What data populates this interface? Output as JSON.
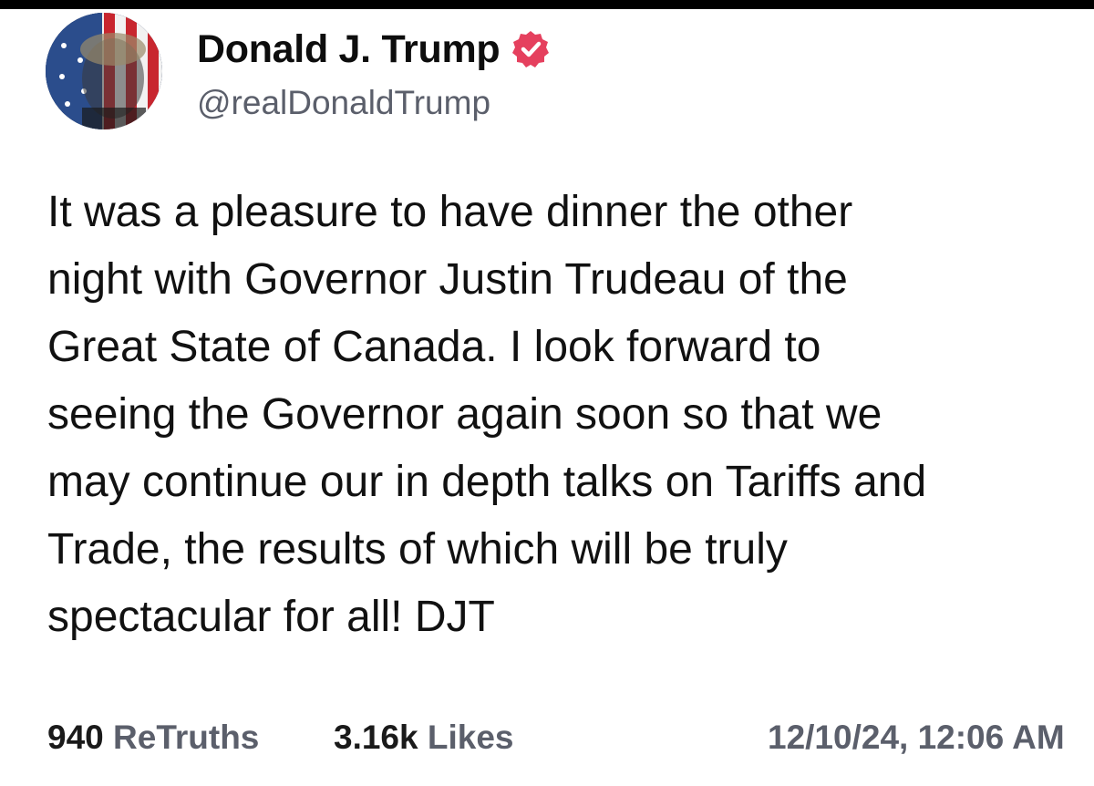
{
  "profile": {
    "display_name": "Donald J. Trump",
    "handle": "@realDonaldTrump",
    "verified_icon": "verified-badge-icon",
    "avatar_icon": "profile-avatar",
    "verified_color": "#e5405e"
  },
  "post": {
    "lines": [
      "It was a pleasure to have dinner the other",
      "night with Governor Justin Trudeau of the",
      "Great State of Canada. I look forward to",
      "seeing the Governor again soon so that we",
      "may continue our in depth talks on Tariffs and",
      "Trade, the results of which will be truly",
      "spectacular for all! DJT"
    ]
  },
  "footer": {
    "retruths_count": "940",
    "retruths_label": "ReTruths",
    "likes_count": "3.16k",
    "likes_label": "Likes",
    "timestamp": "12/10/24, 12:06 AM"
  }
}
